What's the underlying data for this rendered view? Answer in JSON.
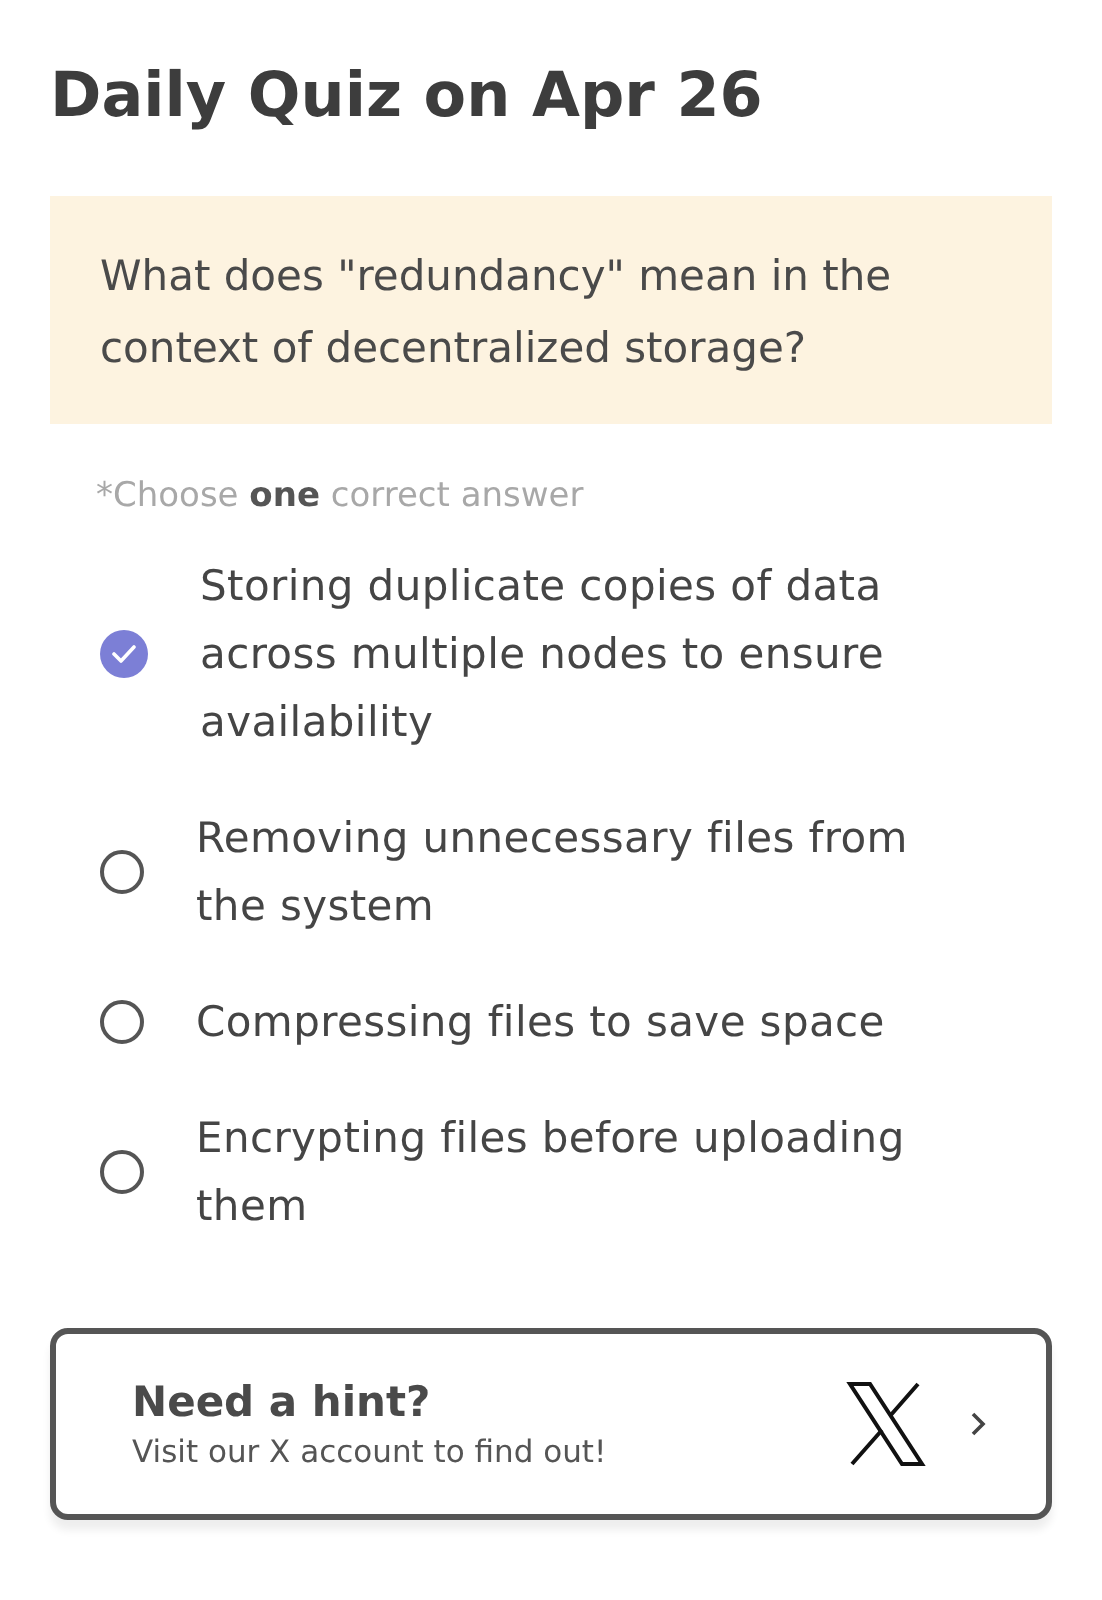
{
  "title": "Daily Quiz on Apr 26",
  "question": "What does \"redundancy\" mean in the context of decentralized storage?",
  "instruction": "*Choose **one** correct answer",
  "options": [
    {
      "label": "Storing duplicate copies of data across multiple nodes to ensure availability",
      "selected": true
    },
    {
      "label": "Removing unnecessary files from the system",
      "selected": false
    },
    {
      "label": "Compressing files to save space",
      "selected": false
    },
    {
      "label": "Encrypting files before uploading them",
      "selected": false
    }
  ],
  "hint": {
    "title": "Need a hint?",
    "text": "Visit our X account to find out!"
  }
}
